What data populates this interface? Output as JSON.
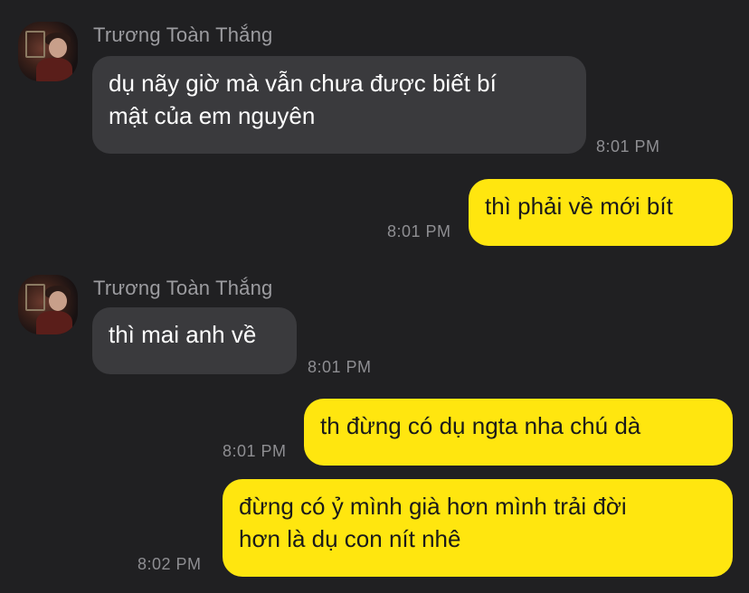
{
  "chat": {
    "messages": [
      {
        "sender": "Trương Toàn Thắng",
        "text_line1": "dụ nãy giờ mà vẫn chưa được biết bí",
        "text_line2": "mật của em nguyên",
        "time": "8:01 PM"
      },
      {
        "text": "thì phải về mới bít",
        "time": "8:01 PM"
      },
      {
        "sender": "Trương Toàn Thắng",
        "text": "thì mai anh về",
        "time": "8:01 PM"
      },
      {
        "text": "th đừng có dụ ngta nha chú dà",
        "time": "8:01 PM"
      },
      {
        "text_line1": "đừng có ỷ mình già hơn mình trải đời",
        "text_line2": "hơn là dụ con nít nhê",
        "time": "8:02 PM"
      }
    ]
  },
  "colors": {
    "background": "#202022",
    "incoming_bubble": "#3a3a3d",
    "outgoing_bubble": "#ffe60f"
  },
  "icons": {
    "avatar": "avatar-photo"
  }
}
